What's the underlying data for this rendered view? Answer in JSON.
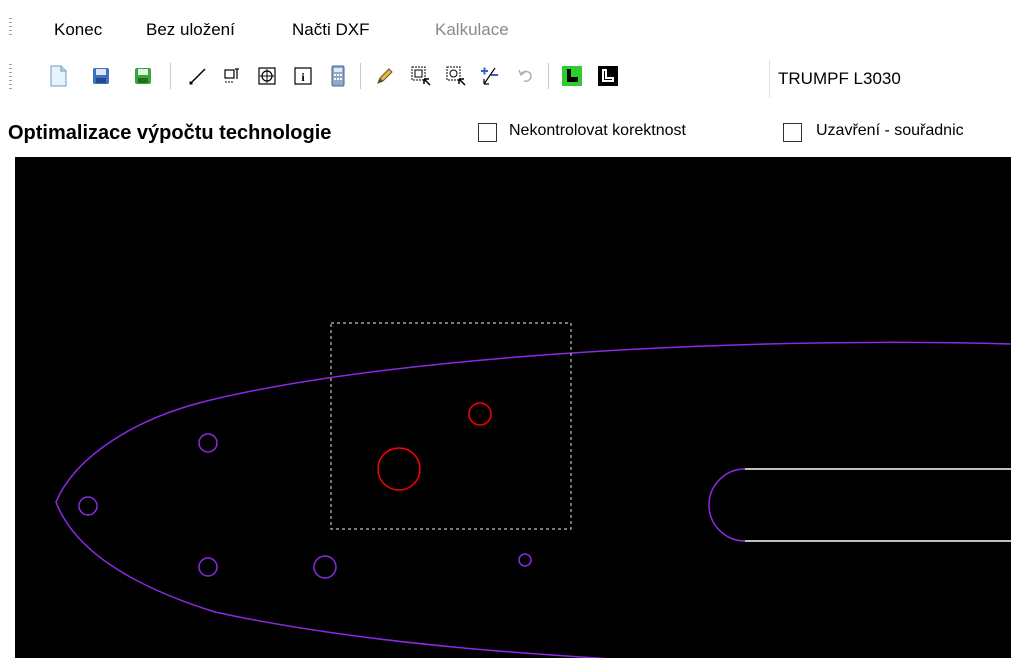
{
  "menu": {
    "items": [
      {
        "label": "Konec",
        "enabled": true
      },
      {
        "label": "Bez uložení",
        "enabled": true
      },
      {
        "label": "Načti DXF",
        "enabled": true
      },
      {
        "label": "Kalkulace",
        "enabled": false
      }
    ]
  },
  "toolbar": {
    "buttons": [
      {
        "icon": "new-document-icon"
      },
      {
        "icon": "save-icon"
      },
      {
        "icon": "save-green-icon"
      },
      {
        "icon": "draw-line-icon"
      },
      {
        "icon": "dimension-icon"
      },
      {
        "icon": "center-target-icon"
      },
      {
        "icon": "info-icon"
      },
      {
        "icon": "calculator-icon"
      },
      {
        "icon": "pencil-icon"
      },
      {
        "icon": "select-window-icon"
      },
      {
        "icon": "select-circle-icon"
      },
      {
        "icon": "add-remove-icon"
      },
      {
        "icon": "undo-icon"
      },
      {
        "icon": "layer-green-icon"
      },
      {
        "icon": "layer-black-icon"
      }
    ],
    "machine": "TRUMPF L3030"
  },
  "options": {
    "title": "Optimalizace výpočtu technologie",
    "check1": {
      "label": "Nekontrolovat korektnost",
      "checked": false
    },
    "check2": {
      "label": "Uzavření - souřadnic",
      "checked": false
    }
  },
  "drawing": {
    "background": "#000000",
    "outline_color": "#8a2be2",
    "selected_color": "#ff0000",
    "selection_box_color": "#bfbfbf",
    "slot_line_color": "#ffffff"
  }
}
